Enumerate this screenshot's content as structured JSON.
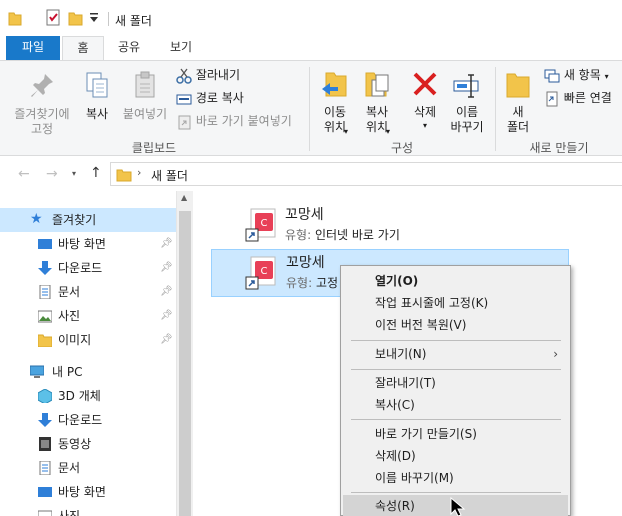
{
  "title_bar": {
    "title": "새 폴더"
  },
  "tabs": [
    {
      "label": "파일"
    },
    {
      "label": "홈"
    },
    {
      "label": "공유"
    },
    {
      "label": "보기"
    }
  ],
  "ribbon": {
    "pin_quick": "즐겨찾기에\n고정",
    "copy": "복사",
    "paste": "붙여넣기",
    "cut": "잘라내기",
    "copy_path": "경로 복사",
    "paste_shortcut": "바로 가기 붙여넣기",
    "clipboard_group": "클립보드",
    "move_to": "이동\n위치",
    "copy_to": "복사\n위치",
    "delete": "삭제",
    "rename": "이름\n바꾸기",
    "organize_group": "구성",
    "new_folder": "새\n폴더",
    "new_item": "새 항목",
    "easy_access": "빠른 연결",
    "new_group": "새로 만들기"
  },
  "address": {
    "path": "새 폴더"
  },
  "nav": {
    "quick_access": "즐겨찾기",
    "items": [
      {
        "label": "바탕 화면",
        "icon": "desktop-icon",
        "pinned": true
      },
      {
        "label": "다운로드",
        "icon": "download-icon",
        "pinned": true
      },
      {
        "label": "문서",
        "icon": "document-icon",
        "pinned": true
      },
      {
        "label": "사진",
        "icon": "pictures-icon",
        "pinned": true
      },
      {
        "label": "이미지",
        "icon": "folder-icon",
        "pinned": true
      }
    ],
    "this_pc": "내 PC",
    "pc_items": [
      {
        "label": "3D 개체",
        "icon": "cube-icon"
      },
      {
        "label": "다운로드",
        "icon": "download-icon"
      },
      {
        "label": "동영상",
        "icon": "video-icon"
      },
      {
        "label": "문서",
        "icon": "document-icon"
      },
      {
        "label": "바탕 화면",
        "icon": "desktop-icon"
      },
      {
        "label": "사진",
        "icon": "pictures-icon"
      }
    ]
  },
  "files": [
    {
      "name": "꼬망세",
      "type_label": "유형:",
      "type_value": "인터넷 바로 가기"
    },
    {
      "name": "꼬망세",
      "type_label": "유형:",
      "type_value": "고정"
    }
  ],
  "context_menu": [
    {
      "label": "열기(O)",
      "bold": true
    },
    {
      "label": "작업 표시줄에 고정(K)"
    },
    {
      "label": "이전 버전 복원(V)"
    },
    {
      "label": "보내기(N)",
      "submenu": true
    },
    {
      "label": "잘라내기(T)"
    },
    {
      "label": "복사(C)"
    },
    {
      "label": "바로 가기 만들기(S)"
    },
    {
      "label": "삭제(D)"
    },
    {
      "label": "이름 바꾸기(M)"
    },
    {
      "label": "속성(R)"
    }
  ],
  "colors": {
    "file_tab": "#1979ca",
    "selection": "#cce8ff",
    "folder": "#f2c44a",
    "shortcut_red": "#e84057"
  }
}
